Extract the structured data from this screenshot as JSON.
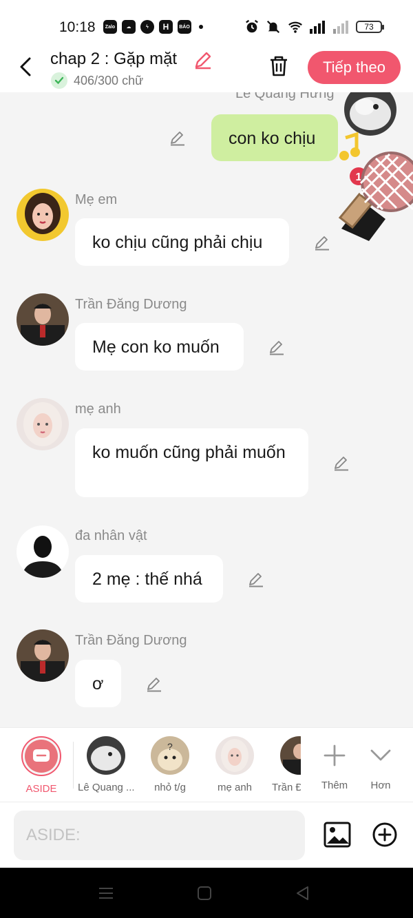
{
  "status_bar": {
    "time": "10:18",
    "battery": "73",
    "app_icons": [
      "Zalo",
      "chat",
      "messenger",
      "H",
      "BÁO MỚI"
    ]
  },
  "header": {
    "title": "chap 2 : Gặp mặt",
    "word_count": "406/300 chữ",
    "next_label": "Tiếp theo"
  },
  "messages": [
    {
      "sender": "Lê Quang Hưng",
      "text": "con ko chịu",
      "mine": true
    },
    {
      "sender": "Mẹ em",
      "text": "ko chịu cũng phải chịu"
    },
    {
      "sender": "Trần Đăng Dương",
      "text": "Mẹ con ko muốn"
    },
    {
      "sender": "mẹ anh",
      "text": "ko muốn cũng phải muốn"
    },
    {
      "sender": "đa nhân vật",
      "text": "2 mẹ : thế nhá"
    },
    {
      "sender": "Trần Đăng Dương",
      "text": "ơ"
    }
  ],
  "sticker": {
    "badge": "1"
  },
  "characters": {
    "items": [
      "ASIDE",
      "Lê Quang ...",
      "nhỏ t/g",
      "mẹ anh",
      "Trần Đ"
    ],
    "add_label": "Thêm",
    "more_label": "Hơn"
  },
  "input": {
    "placeholder": "ASIDE:"
  },
  "colors": {
    "accent": "#f1576e",
    "my_bubble": "#cfeea0",
    "background": "#f4f4f4"
  }
}
